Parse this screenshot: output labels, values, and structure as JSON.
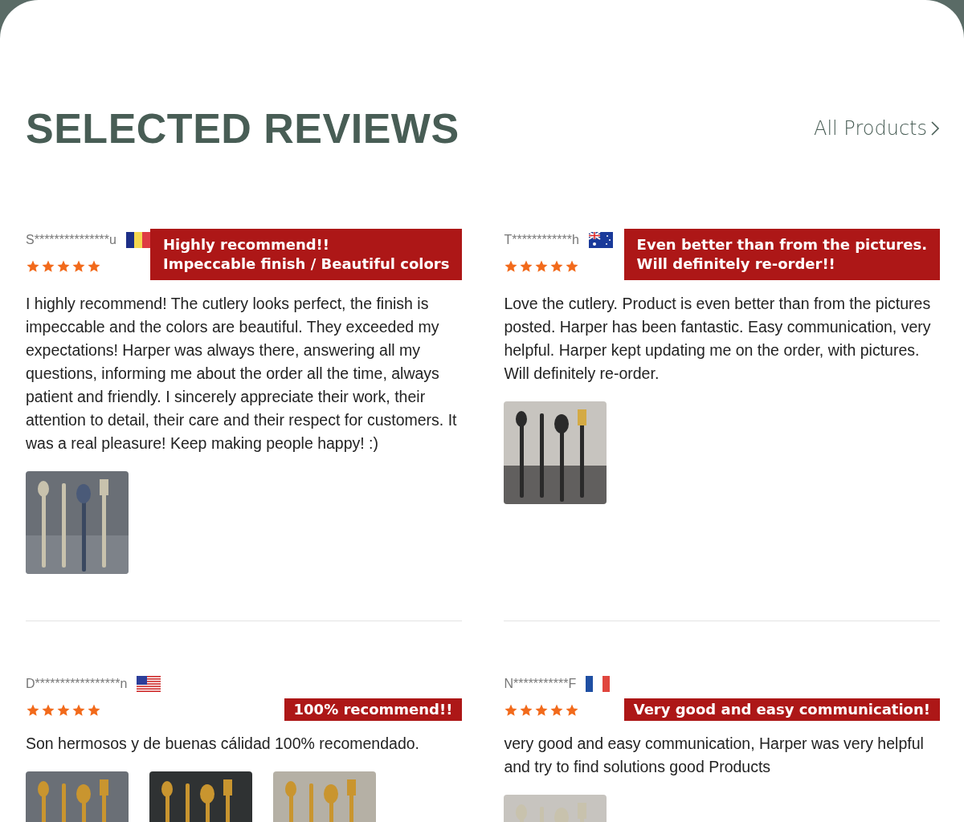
{
  "header": {
    "title": "SELECTED REVIEWS",
    "link": "All Products"
  },
  "reviews": [
    {
      "name": "S***************u",
      "kind": "romania",
      "stars": 5,
      "badge": [
        "Highly recommend!!",
        "Impeccable finish / Beautiful colors"
      ],
      "text": "I highly recommend! The cutlery looks perfect, the finish is impeccable and the colors are beautiful. They exceeded my expectations! Harper was always there, answering all my questions, informing me about the order all the time, always patient and friendly. I sincerely appreciate their work, their attention to detail, their care and their respect for customers. It was a real pleasure! Keep making people happy! :)",
      "photos": [
        {
          "kind": "picture"
        }
      ]
    },
    {
      "name": "T************h",
      "kind": "australia",
      "stars": 5,
      "badge": [
        "Even better than from the pictures.",
        "Will definitely re-order!!"
      ],
      "text": "Love the cutlery. Product is even better than from the pictures posted. Harper has been fantastic. Easy communication, very helpful. Harper kept updating me on the order, with pictures. Will definitely re-order.",
      "photos": [
        {
          "kind": "picture"
        }
      ]
    },
    {
      "name": "D*****************n",
      "kind": "usa",
      "stars": 5,
      "badge": [
        "100% recommend!!"
      ],
      "text": "Son hermosos y de buenas cálidad 100% recomendado.",
      "photos": [
        {
          "kind": "picture"
        },
        {
          "kind": "picture"
        },
        {
          "kind": "picture"
        }
      ]
    },
    {
      "name": "N***********F",
      "kind": "france",
      "stars": 5,
      "badge": [
        "Very good and easy communication!"
      ],
      "text": "very good and easy communication, Harper was very helpful and try to find solutions good Products",
      "photos": [
        {
          "kind": "picture"
        }
      ]
    }
  ]
}
